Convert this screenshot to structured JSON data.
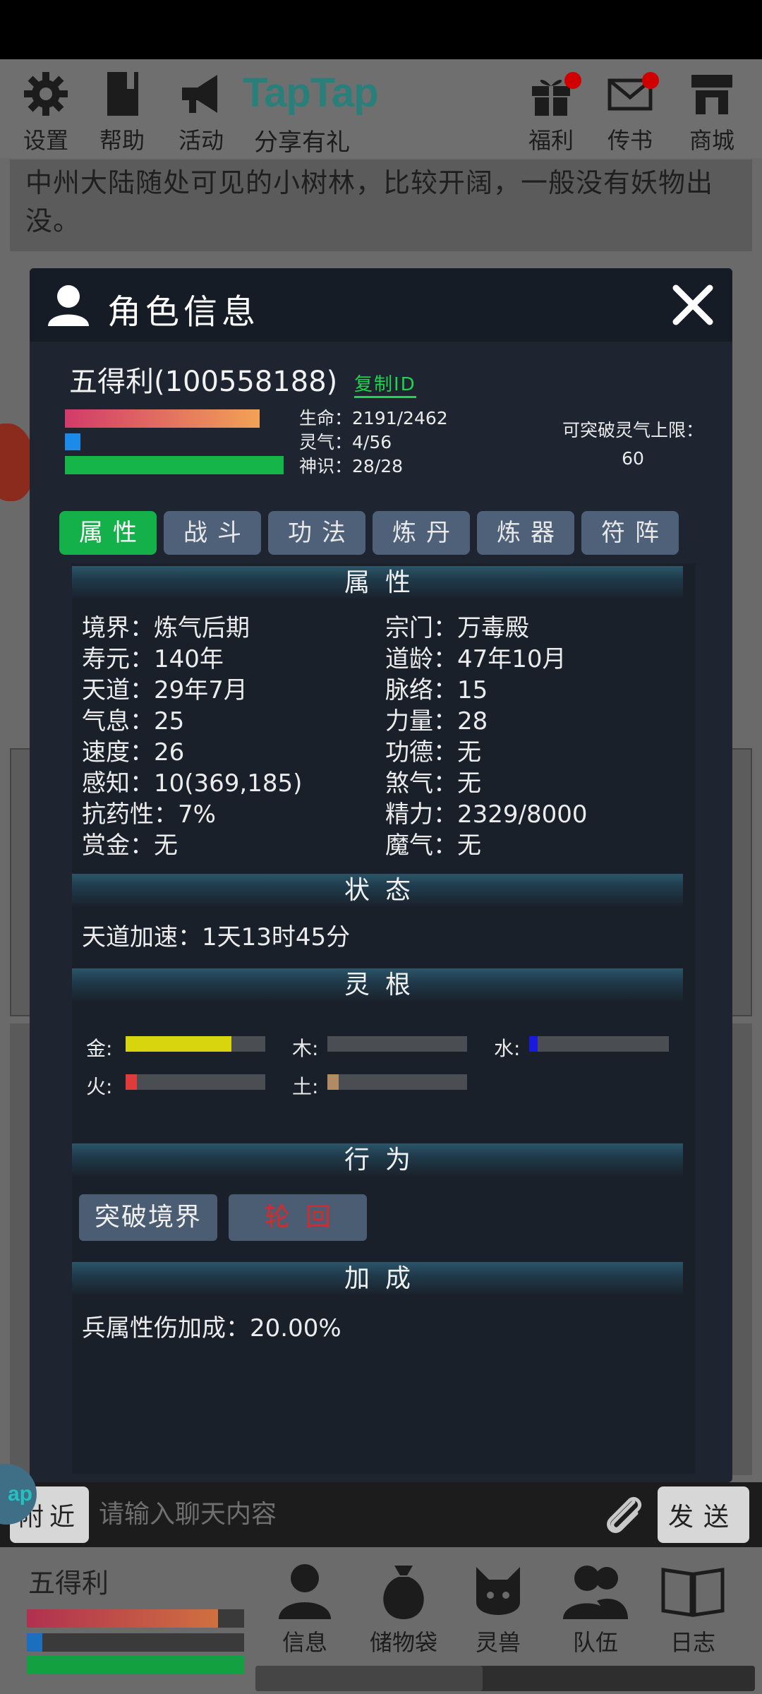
{
  "topbar": {
    "items": [
      {
        "label": "设置",
        "icon": "gear-icon"
      },
      {
        "label": "帮助",
        "icon": "book-icon"
      },
      {
        "label": "活动",
        "icon": "megaphone-icon"
      },
      {
        "label": "福利",
        "icon": "gift-icon"
      },
      {
        "label": "传书",
        "icon": "mail-icon"
      },
      {
        "label": "商城",
        "icon": "shop-icon"
      }
    ],
    "taptap_logo": "TapTap",
    "share_label": "分享有礼"
  },
  "location_desc": "中州大陆随处可见的小树林，比较开阔，一般没有妖物出没。",
  "modal": {
    "title": "角色信息",
    "char_name": "五得利(100558188)",
    "copy_id": "复制ID",
    "stats": {
      "life": "生命：2191/2462",
      "spirit": "灵气：4/56",
      "sense": "神识：28/28",
      "life_ratio": 0.89,
      "spirit_ratio": 0.07,
      "sense_ratio": 1.0
    },
    "break_limit_label": "可突破灵气上限：",
    "break_limit_value": "60",
    "tabs": [
      "属性",
      "战斗",
      "功法",
      "炼丹",
      "炼器",
      "符阵"
    ],
    "active_tab": "属性",
    "sections": {
      "attributes": "属性",
      "status": "状态",
      "roots": "灵根",
      "actions": "行为",
      "bonus": "加成"
    },
    "attributes": [
      {
        "left": "境界：炼气后期",
        "right": "宗门：万毒殿"
      },
      {
        "left": "寿元：140年",
        "right": "道龄：47年10月"
      },
      {
        "left": "天道：29年7月",
        "right": "脉络：15"
      },
      {
        "left": "气息：25",
        "right": "力量：28"
      },
      {
        "left": "速度：26",
        "right": "功德：无"
      },
      {
        "left": "感知：10(369,185)",
        "right": "煞气：无"
      },
      {
        "left": "抗药性：7%",
        "right": "精力：2329/8000"
      },
      {
        "left": "赏金：无",
        "right": "魔气：无"
      }
    ],
    "status_text": "天道加速：1天13时45分",
    "roots": [
      {
        "label": "金:",
        "value": 0.76,
        "color": "#d8d40e"
      },
      {
        "label": "木:",
        "value": 0.0,
        "color": "#888888"
      },
      {
        "label": "水:",
        "value": 0.06,
        "color": "#1a1adf"
      },
      {
        "label": "火:",
        "value": 0.08,
        "color": "#e03a3a"
      },
      {
        "label": "土:",
        "value": 0.08,
        "color": "#b28a63"
      }
    ],
    "btn_break": "突破境界",
    "btn_reincarnate": "轮回",
    "bonus_text": "兵属性伤加成：20.00%"
  },
  "chat": {
    "channel": "附近",
    "placeholder": "请输入聊天内容",
    "send": "发送"
  },
  "tap_badge": "ap",
  "bottom": {
    "name": "五得利",
    "nav": [
      "信息",
      "储物袋",
      "灵兽",
      "队伍",
      "日志"
    ]
  }
}
